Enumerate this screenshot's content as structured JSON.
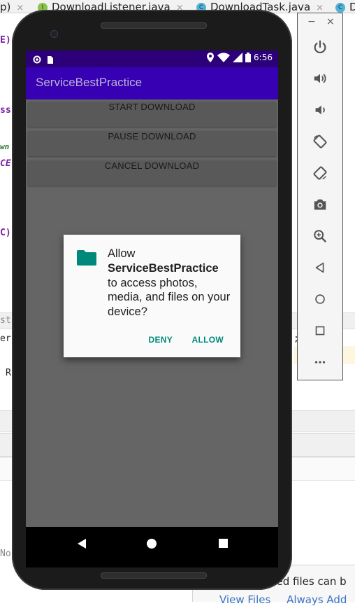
{
  "ide": {
    "tabs": [
      {
        "label": "p)"
      },
      {
        "label": "DownloadListener.java",
        "icon_letter": "I",
        "icon_color": "#8bc34a"
      },
      {
        "label": "DownloadTask.java",
        "icon_letter": "C",
        "icon_color": "#4fb3d9"
      },
      {
        "label": "D",
        "icon_letter": "C",
        "icon_color": "#4fb3d9"
      }
    ],
    "code_left": [
      "E)",
      "ss)",
      "wn",
      "CE,",
      "C)",
      "st(",
      "er",
      "R",
      "No"
    ],
    "code_right": [
      ";"
    ],
    "notification": {
      "text": "ded files can b",
      "links": [
        "View Files",
        "Always Add"
      ]
    }
  },
  "emulator_bar": {
    "minimize": "−",
    "close": "×",
    "buttons": [
      "power-icon",
      "volume-up-icon",
      "volume-down-icon",
      "rotate-left-icon",
      "rotate-right-icon",
      "camera-icon",
      "zoom-icon",
      "back-icon",
      "home-icon",
      "overview-icon",
      "more-icon"
    ]
  },
  "status_bar": {
    "time": "6:56"
  },
  "app": {
    "title": "ServiceBestPractice",
    "buttons": {
      "start": "START DOWNLOAD",
      "pause": "PAUSE DOWNLOAD",
      "cancel": "CANCEL DOWNLOAD"
    }
  },
  "dialog": {
    "line1": "Allow",
    "app_name": "ServiceBestPractice",
    "message": "to access photos, media, and files on your device?",
    "deny": "DENY",
    "allow": "ALLOW"
  },
  "colors": {
    "status_bar": "#2b0079",
    "app_bar": "#3700b3",
    "accent": "#00897b",
    "content_bg": "#656565"
  }
}
